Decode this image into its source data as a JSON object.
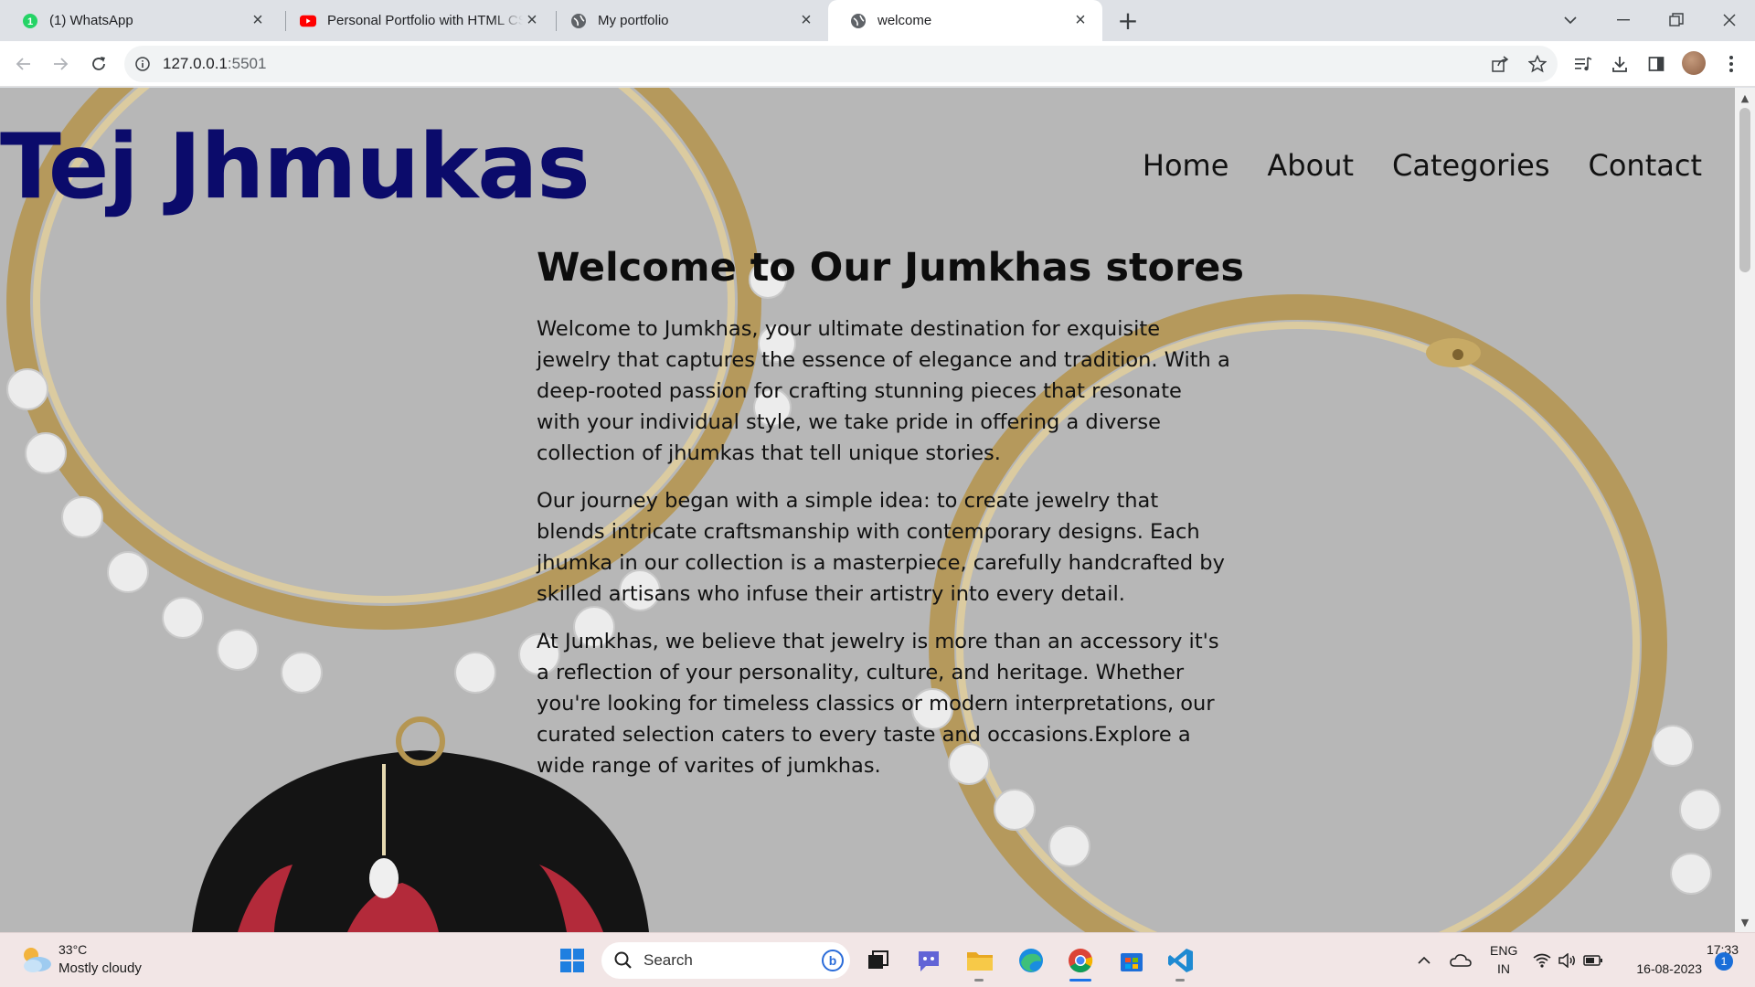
{
  "browser": {
    "tabs": [
      {
        "title": "(1) WhatsApp",
        "favicon": "whatsapp-icon",
        "badge": "1",
        "close": "×"
      },
      {
        "title": "Personal Portfolio with HTML CSS",
        "favicon": "youtube-icon",
        "close": "×"
      },
      {
        "title": "My portfolio",
        "favicon": "globe-icon",
        "close": "×"
      },
      {
        "title": "welcome",
        "favicon": "globe-icon",
        "close": "×",
        "active": true
      }
    ],
    "new_tab": "+",
    "address_host": "127.0.0.1",
    "address_port": ":5501"
  },
  "page": {
    "logo": "Tej Jhmukas",
    "nav": [
      "Home",
      "About",
      "Categories",
      "Contact"
    ],
    "title": "Welcome to Our Jumkhas stores",
    "paragraphs": [
      "Welcome to Jumkhas, your ultimate destination for exquisite jewelry that captures the essence of elegance and tradition. With a deep-rooted passion for crafting stunning pieces that resonate with your individual style, we take pride in offering a diverse collection of jhumkas that tell unique stories.",
      "Our journey began with a simple idea: to create jewelry that blends intricate craftsmanship with contemporary designs. Each jhumka in our collection is a masterpiece, carefully handcrafted by skilled artisans who infuse their artistry into every detail.",
      "At Jumkhas, we believe that jewelry is more than an accessory it's a reflection of your personality, culture, and heritage. Whether you're looking for timeless classics or modern interpretations, our curated selection caters to every taste and occasions.Explore a wide range of varites of jumkhas."
    ],
    "colors": {
      "logo": "#0b0b6b",
      "overlay": "#b3b3b3"
    }
  },
  "taskbar": {
    "weather_temp": "33°C",
    "weather_desc": "Mostly cloudy",
    "search_placeholder": "Search",
    "lang_top": "ENG",
    "lang_bottom": "IN",
    "time": "17:33",
    "date": "16-08-2023",
    "notification_count": "1"
  }
}
